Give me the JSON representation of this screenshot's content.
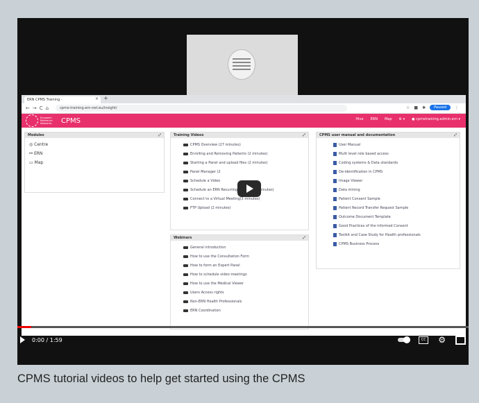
{
  "browser": {
    "tab_title": "ERN CPMS Training -",
    "url": "cpms-training.ern-net.eu/insight/",
    "profile_label": "Paused"
  },
  "app": {
    "brand_small": "European Reference Networks",
    "brand": "CPMS",
    "topnav": [
      "Hive",
      "ERN",
      "Map",
      "⚙ ▾",
      "● cpmstraining.admin.ern ▾"
    ]
  },
  "panels": {
    "modules": {
      "title": "Modules",
      "items": [
        "Centre",
        "ERN",
        "Map"
      ]
    },
    "training": {
      "title": "Training Videos",
      "items": [
        "CPMS Overview (27 minutes)",
        "Enrolling and Removing Patients (2 minutes)",
        "Starting a Panel and upload files (2 minutes)",
        "Panel Manager (2",
        "Schedule a Video",
        "Schedule an ERN Recurring Meeting (2 minutes)",
        "Connect to a Virtual Meeting(3 minutes)",
        "FTP Upload (2 minutes)"
      ]
    },
    "webinars": {
      "title": "Webinars",
      "items": [
        "General introduction",
        "How to use the Consultation Form",
        "How to form an Expert Panel",
        "How to schedule video meetings",
        "How to use the Medical Viewer",
        "Users Access rights",
        "Non-ERN Health Professionals",
        "ERN Coordination"
      ]
    },
    "manual": {
      "title": "CPMS user manual and documentation",
      "items": [
        "User Manual",
        "Multi level role based access",
        "Coding systems & Data standards",
        "De-identification in CPMS",
        "Image Viewer",
        "Data mining",
        "Patient Consent Sample",
        "Patient Record Transfer Request Sample",
        "Outcome Document Template",
        "Good Practices of the informed Consent",
        "Toolkit and Case Study for Health professionals",
        "CPMS Business Process"
      ]
    }
  },
  "player": {
    "time": "0:00 / 1:59",
    "progress": 0.03
  },
  "caption": "CPMS tutorial videos to help get started using the CPMS"
}
